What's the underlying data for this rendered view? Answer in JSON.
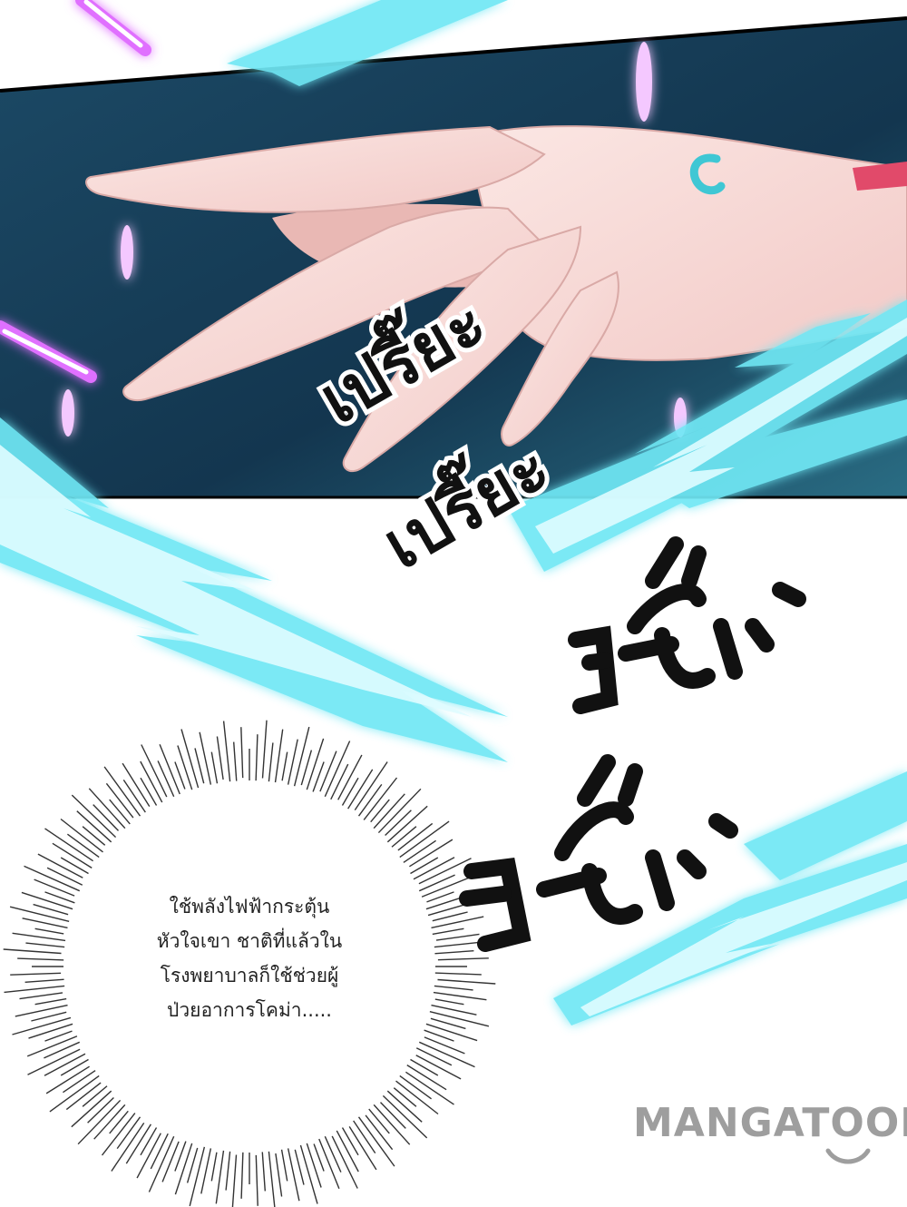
{
  "panel_top": {
    "sfx_lines": [
      "เปรี๊ยะ",
      "เปรี๊ยะ"
    ]
  },
  "narration_bubble": {
    "lines": [
      "ใช้พลังไฟฟ้ากระตุ้น",
      "หัวใจเขา ชาติที่แล้วใน",
      "โรงพยาบาลก็ใช้ช่วยผู้",
      "ป่วยอาการโคม่า....."
    ]
  },
  "watermark": {
    "text": "MANGATOON"
  },
  "colors": {
    "panel_bg_dark": "#0f2c46",
    "panel_bg_light": "#2c6f85",
    "lightning": "#6fe8f5",
    "sparkle_pink": "#e070ff",
    "skin": "#f7d9d6",
    "bracelet": "#3fc7d4",
    "watermark": "#9e9e9e"
  }
}
